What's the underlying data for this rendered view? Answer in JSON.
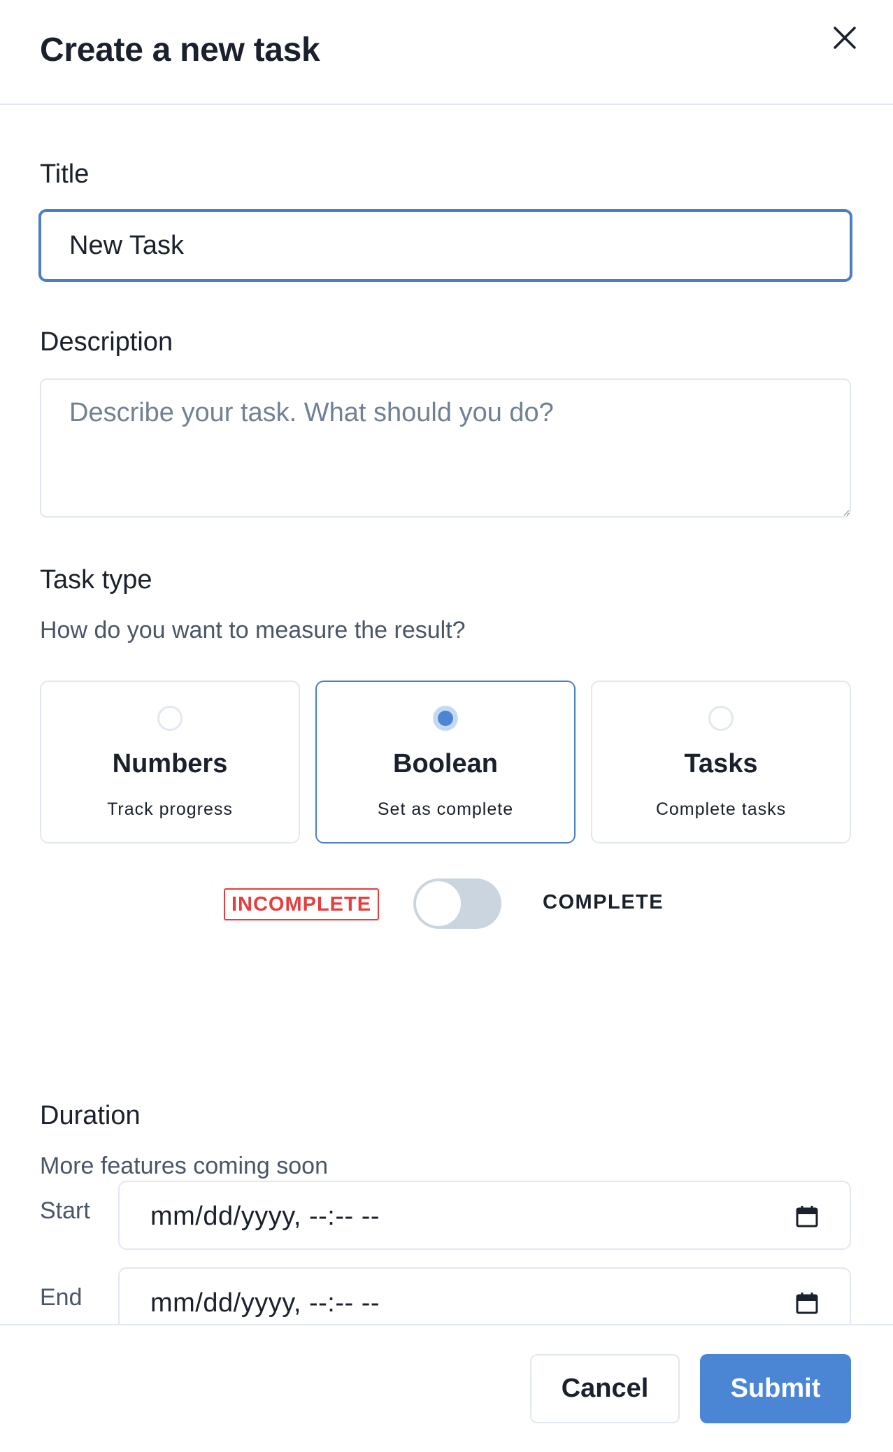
{
  "header": {
    "title": "Create a new task"
  },
  "form": {
    "title_label": "Title",
    "title_value": "New Task",
    "description_label": "Description",
    "description_placeholder": "Describe your task. What should you do?",
    "task_type_label": "Task type",
    "task_type_hint": "How do you want to measure the result?",
    "task_types": [
      {
        "title": "Numbers",
        "subtitle": "Track progress",
        "selected": false
      },
      {
        "title": "Boolean",
        "subtitle": "Set as complete",
        "selected": true
      },
      {
        "title": "Tasks",
        "subtitle": "Complete tasks",
        "selected": false
      }
    ],
    "toggle": {
      "off_label": "INCOMPLETE",
      "on_label": "COMPLETE",
      "checked": false
    },
    "duration_label": "Duration",
    "duration_hint": "More features coming soon",
    "start_label": "Start",
    "start_value": "mm/dd/yyyy, --:-- --",
    "end_label": "End",
    "end_value": "mm/dd/yyyy, --:-- --"
  },
  "footer": {
    "cancel_label": "Cancel",
    "submit_label": "Submit"
  },
  "colors": {
    "accent": "#4a86d4",
    "focus_border": "#4a7fc8",
    "incomplete_red": "#e53e3e",
    "border": "#e2e8f0",
    "toggle_track": "#cbd5e0"
  },
  "icons": {
    "close": "close-icon",
    "calendar": "calendar-icon"
  }
}
